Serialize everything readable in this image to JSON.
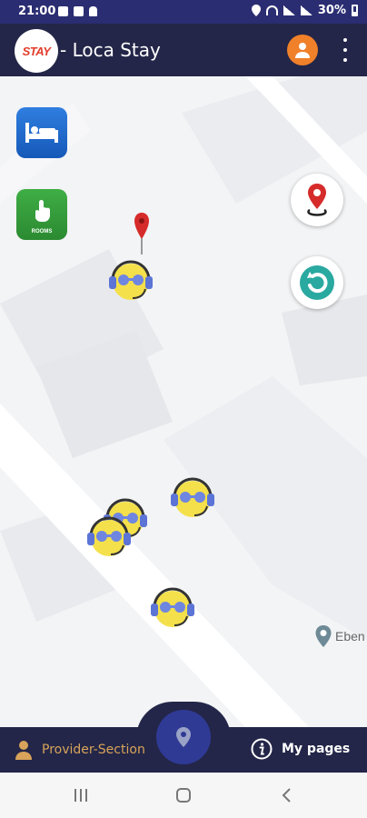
{
  "status_bar": {
    "time": "21:00",
    "battery": "30%"
  },
  "app_bar": {
    "logo_text": "STAY",
    "title": "- Loca Stay"
  },
  "map": {
    "label": "Eben",
    "buttons": {
      "rooms_label": "ROOMS"
    }
  },
  "bottom_nav": {
    "provider_label": "Provider-Section",
    "pages_label": "My pages"
  },
  "colors": {
    "app_bar": "#232648",
    "status_bar": "#2b2d72",
    "accent_orange": "#f0802a",
    "provider_text": "#d8a35a",
    "pin_red": "#d62b2b",
    "refresh_teal": "#2aa9a0"
  },
  "icons": [
    "profile-icon",
    "more-vert-icon",
    "bed-icon",
    "touch-icon",
    "location-pin-icon",
    "refresh-icon",
    "person-icon",
    "info-icon",
    "map-marker-icon"
  ]
}
